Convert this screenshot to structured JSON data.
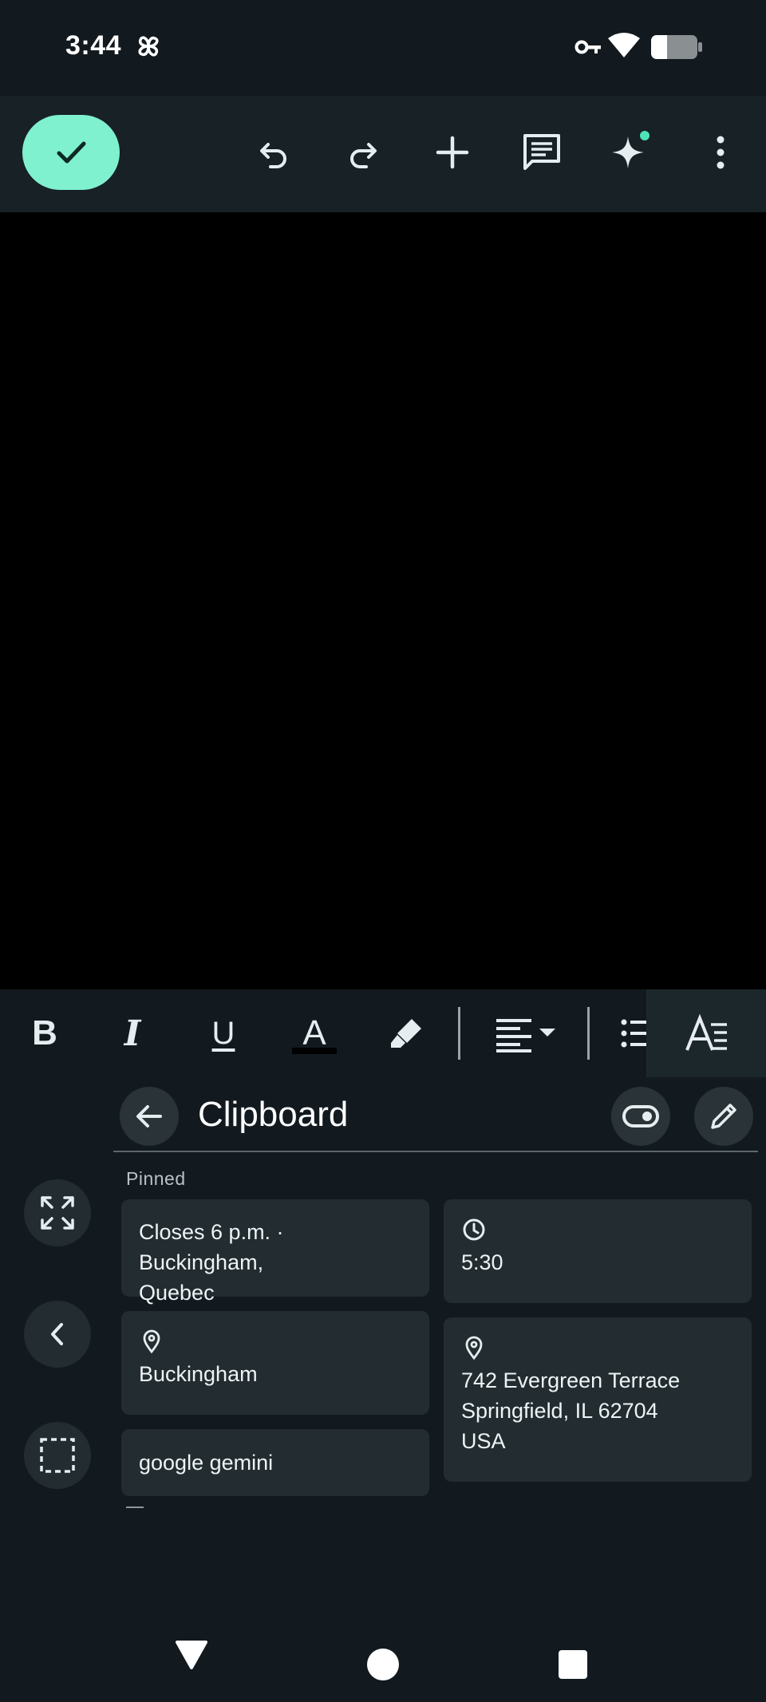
{
  "status_bar": {
    "time": "3:44",
    "icons": [
      "pinwheel-icon",
      "vpn-key-icon",
      "wifi-icon",
      "battery-icon"
    ]
  },
  "toolbar": {
    "done_icon": "check-icon",
    "actions": [
      "undo-icon",
      "redo-icon",
      "add-icon",
      "comment-icon",
      "gemini-sparkle-icon",
      "more-vert-icon"
    ],
    "accent_color": "#7ff1cf"
  },
  "format_bar": {
    "bold_label": "B",
    "italic_label": "I",
    "underline_label": "U",
    "text_color_label": "A",
    "text_color_value": "#000000",
    "icons": [
      "highlighter-icon",
      "align-left-icon",
      "bulleted-list-icon",
      "text-style-icon"
    ]
  },
  "clipboard": {
    "title": "Clipboard",
    "section_label": "Pinned",
    "cards": [
      {
        "icon": "",
        "text_lines": [
          "Closes 6 p.m. · Buckingham,",
          "Quebec"
        ]
      },
      {
        "icon": "clock-icon",
        "text_lines": [
          "5:30"
        ]
      },
      {
        "icon": "location-pin-icon",
        "text_lines": [
          "Buckingham"
        ]
      },
      {
        "icon": "location-pin-icon",
        "text_lines": [
          "742 Evergreen Terrace",
          "Springfield, IL 62704",
          "USA"
        ]
      },
      {
        "icon": "",
        "text_lines": [
          "google gemini"
        ]
      }
    ],
    "side_actions": [
      "expand-icon",
      "chevron-left-icon",
      "select-icon"
    ]
  },
  "nav_bar": {
    "buttons": [
      "back-triangle-icon",
      "home-circle-icon",
      "recents-square-icon"
    ]
  }
}
